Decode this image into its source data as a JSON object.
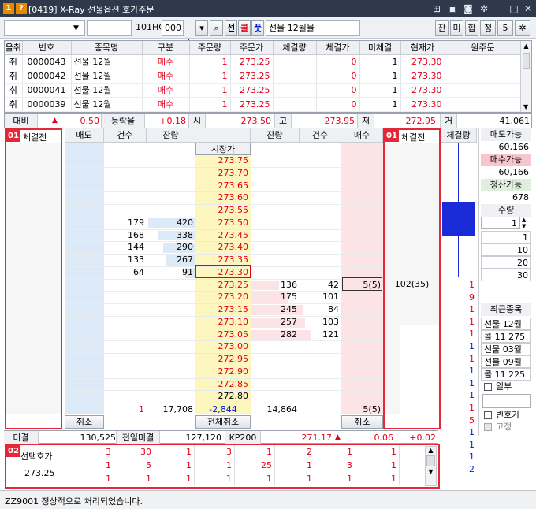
{
  "window": {
    "badge1": "1",
    "badge2": "?",
    "title": "[0419] X-Ray 선물옵션 호가주문"
  },
  "toolbar": {
    "account": "",
    "password": "",
    "code": "101HC",
    "type": "000",
    "btn_sun": "선",
    "btn_kol": "콜",
    "btn_put": "풋",
    "product": "선물 12월물",
    "btns": [
      "잔",
      "미",
      "합",
      "정",
      "5"
    ]
  },
  "orders": {
    "headers": [
      "을취",
      "번호",
      "종목명",
      "구분",
      "주문량",
      "주문가",
      "체결량",
      "체결가",
      "미체결",
      "현재가",
      "원주문"
    ],
    "rows": [
      [
        "취",
        "0000043",
        "선물 12월",
        "매수",
        "1",
        "273.25",
        "",
        "0",
        "1",
        "273.30",
        ""
      ],
      [
        "취",
        "0000042",
        "선물 12월",
        "매수",
        "1",
        "273.25",
        "",
        "0",
        "1",
        "273.30",
        ""
      ],
      [
        "취",
        "0000041",
        "선물 12월",
        "매수",
        "1",
        "273.25",
        "",
        "0",
        "1",
        "273.30",
        ""
      ],
      [
        "취",
        "0000039",
        "선물 12월",
        "매수",
        "1",
        "273.25",
        "",
        "0",
        "1",
        "273.30",
        ""
      ]
    ]
  },
  "stats": {
    "l1": "대비",
    "v1": "0.50",
    "l2": "등락율",
    "v2": "+0.18",
    "l3": "시",
    "v3": "273.50",
    "l4": "고",
    "v4": "273.95",
    "l5": "저",
    "v5": "272.95",
    "l6": "거",
    "v6": "41,061"
  },
  "ladder": {
    "badge_left": "01",
    "label_left": "체결전",
    "badge_right": "01",
    "label_right": "체결전",
    "headers": {
      "sell": "매도",
      "cnt": "건수",
      "qty": "잔량",
      "price": "시장가",
      "qty2": "잔량",
      "cnt2": "건수",
      "buy": "매수",
      "exec": "체결량"
    },
    "prices": [
      "273.75",
      "273.70",
      "273.65",
      "273.60",
      "273.55",
      "273.50",
      "273.45",
      "273.40",
      "273.35",
      "273.30",
      "273.25",
      "273.20",
      "273.15",
      "273.10",
      "273.05",
      "273.00",
      "272.95",
      "272.90",
      "272.85",
      "272.80"
    ],
    "ask_rows": [
      {
        "cnt": "",
        "qty": ""
      },
      {
        "cnt": "",
        "qty": ""
      },
      {
        "cnt": "",
        "qty": ""
      },
      {
        "cnt": "",
        "qty": ""
      },
      {
        "cnt": "",
        "qty": ""
      },
      {
        "cnt": "179",
        "qty": "420"
      },
      {
        "cnt": "168",
        "qty": "338"
      },
      {
        "cnt": "144",
        "qty": "290"
      },
      {
        "cnt": "133",
        "qty": "267"
      },
      {
        "cnt": "64",
        "qty": "91"
      }
    ],
    "bid_rows": [
      {
        "qty": "136",
        "cnt": "42",
        "buy": "5(5)"
      },
      {
        "qty": "175",
        "cnt": "101",
        "buy": ""
      },
      {
        "qty": "245",
        "cnt": "84",
        "buy": ""
      },
      {
        "qty": "257",
        "cnt": "103",
        "buy": ""
      },
      {
        "qty": "282",
        "cnt": "121",
        "buy": ""
      }
    ],
    "ask_bar_ratio": [
      0,
      0,
      0,
      0,
      0,
      1.0,
      0.8,
      0.69,
      0.64,
      0.22
    ],
    "bid_bar_ratio": [
      0.48,
      0.62,
      0.87,
      0.91,
      1.0
    ],
    "right_exec": "102(35)",
    "footer": {
      "sell_cnt": "1",
      "sell_qty": "17,708",
      "diff": "-2,844",
      "buy_qty": "14,864",
      "buy_pending": "5(5)",
      "cancel_left": "취소",
      "cancel_all": "전체취소",
      "cancel_right": "취소"
    }
  },
  "ticks": [
    "1",
    "9",
    "1",
    "1",
    "1",
    "1",
    "1",
    "1",
    "1",
    "1",
    "1",
    "5",
    "1",
    "1",
    "1",
    "2"
  ],
  "tick_colors": [
    "r",
    "r",
    "r",
    "r",
    "r",
    "b",
    "r",
    "b",
    "b",
    "b",
    "r",
    "r",
    "b",
    "b",
    "b",
    "b"
  ],
  "side": {
    "sell_avail_l": "매도가능",
    "sell_avail": "60,166",
    "buy_avail_l": "매수가능",
    "buy_avail": "60,166",
    "clear_avail_l": "청산가능",
    "clear_avail": "678",
    "qty_l": "수량",
    "qty": "1",
    "qty_opts": [
      "1",
      "10",
      "20",
      "30"
    ],
    "recent_l": "최근종목",
    "recent": [
      "선물 12월",
      "콜 11 275",
      "선물 03월",
      "선물 09월",
      "콜 11 225"
    ],
    "chk_partial": "일부",
    "chk_empty": "빈호가",
    "chk_fixed": "고정"
  },
  "bottom": {
    "l1": "미결",
    "v1": "130,525",
    "l2": "전일미결",
    "v2": "127,120",
    "l3": "KP200",
    "v3": "271.17",
    "v4": "0.06",
    "v5": "+0.02"
  },
  "select": {
    "badge": "02",
    "label": "선택호가",
    "price": "273.25",
    "rows": [
      [
        "3",
        "30",
        "1",
        "3",
        "1",
        "2",
        "1",
        "1"
      ],
      [
        "1",
        "5",
        "1",
        "1",
        "25",
        "1",
        "3",
        "1"
      ],
      [
        "1",
        "1",
        "1",
        "1",
        "1",
        "1",
        "1",
        "1"
      ]
    ]
  },
  "status": {
    "msg": "ZZ9001 정상적으로 처리되었습니다."
  },
  "colors": {
    "ask_bg": "#dce9f7",
    "bid_bg": "#fbe3e6",
    "price_bg": "#fdf6bf",
    "red": "#e3001b",
    "blue": "#0020d0"
  }
}
